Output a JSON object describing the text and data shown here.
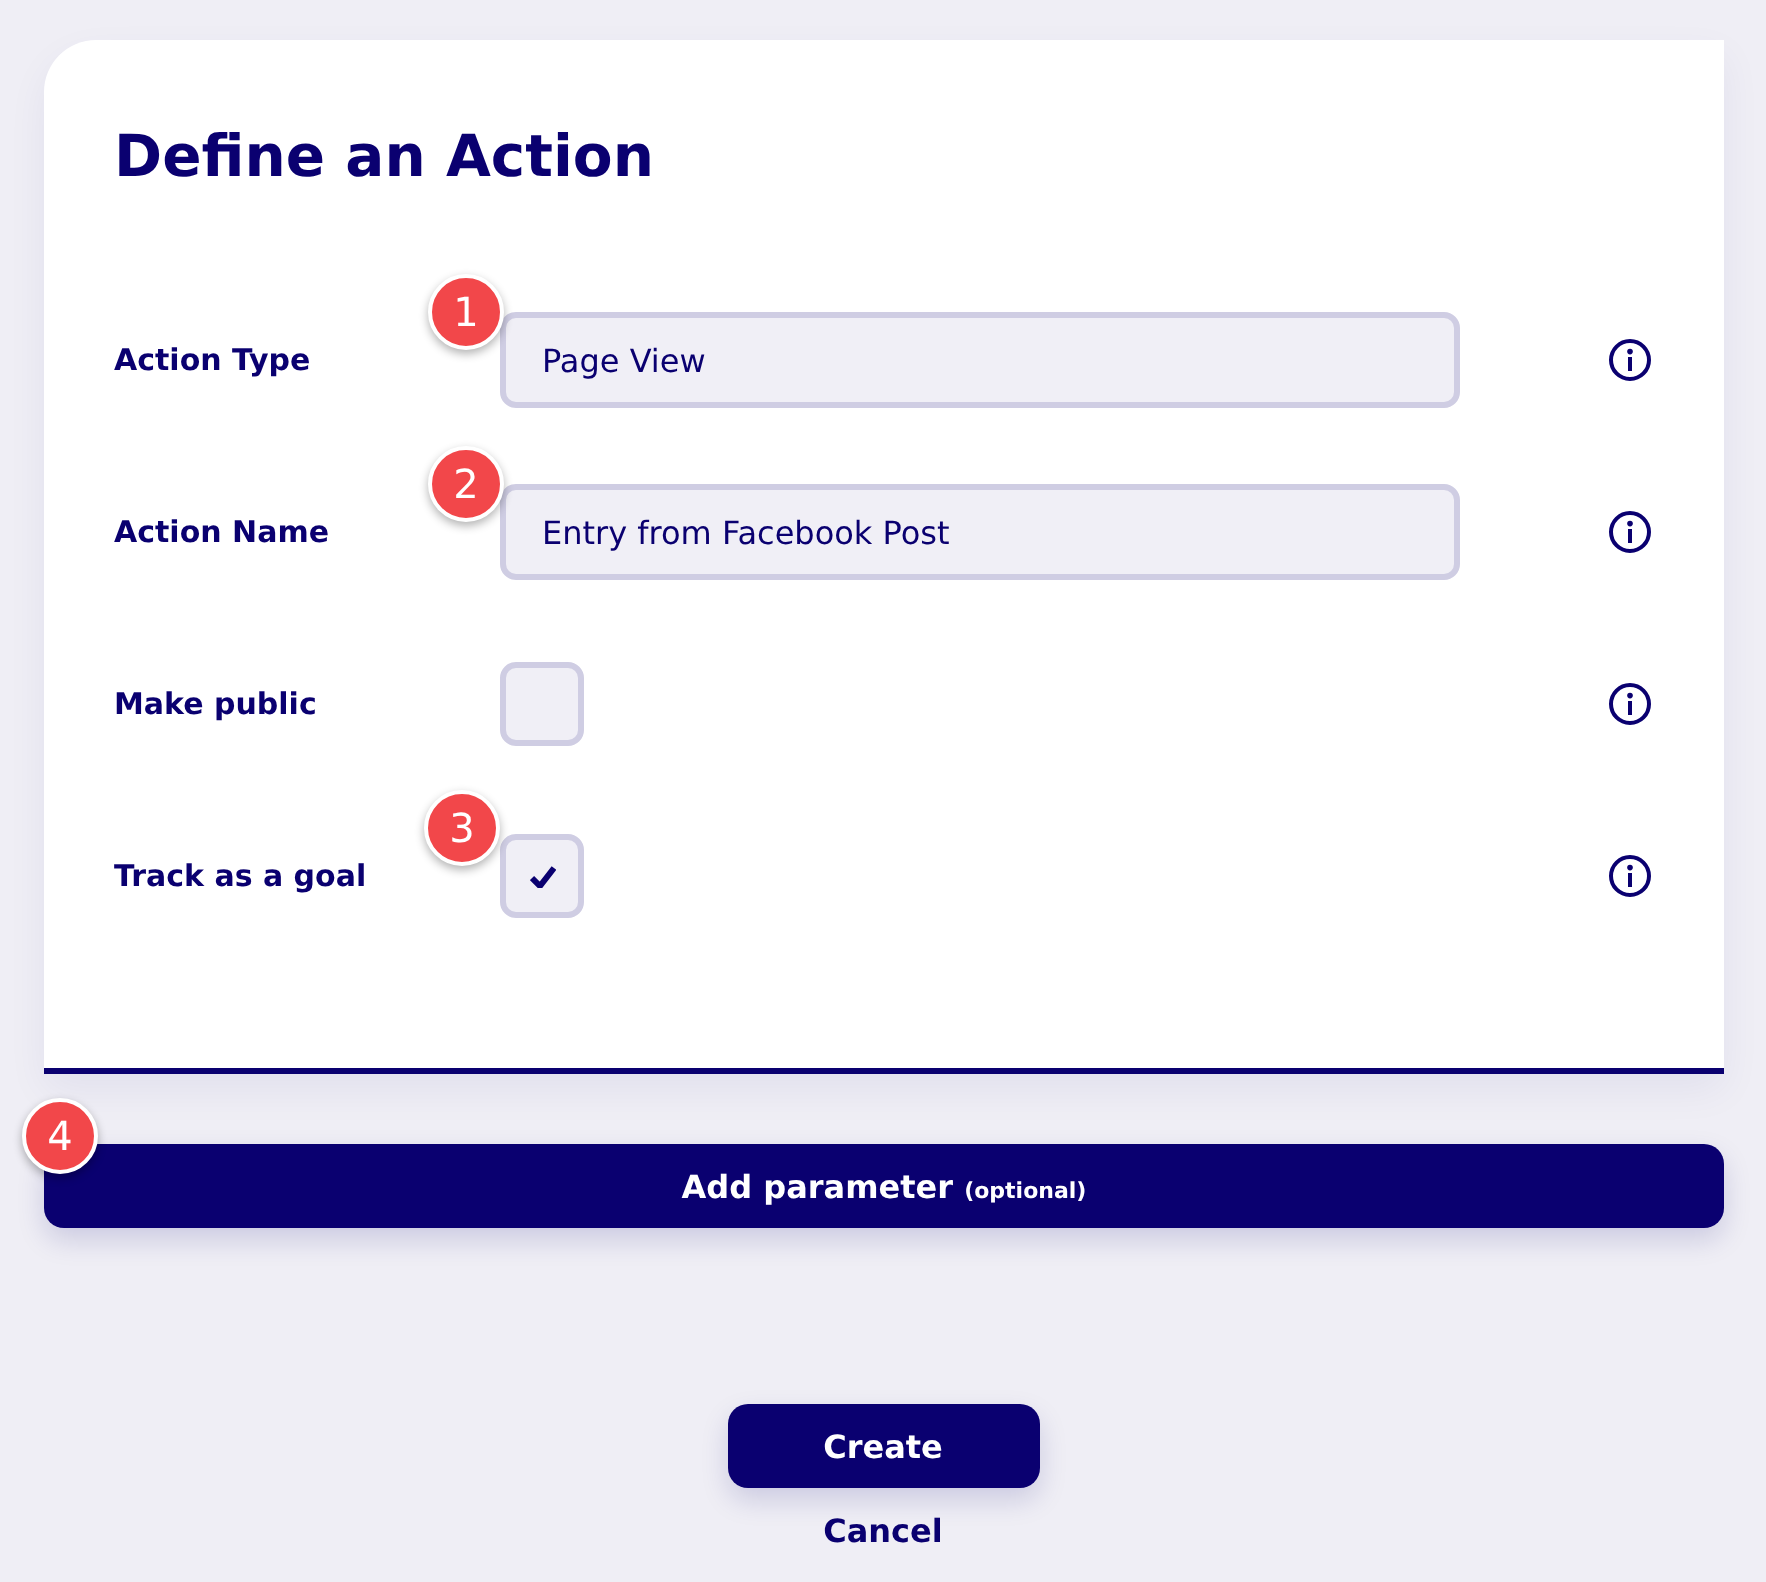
{
  "title": "Define an Action",
  "fields": [
    {
      "kind": "text",
      "label": "Action Type",
      "value": "Page View",
      "badge": "1"
    },
    {
      "kind": "text",
      "label": "Action Name",
      "value": "Entry from Facebook Post",
      "badge": "2"
    },
    {
      "kind": "checkbox",
      "label": "Make public",
      "checked": false
    },
    {
      "kind": "checkbox",
      "label": "Track as a goal",
      "checked": true,
      "badge": "3"
    }
  ],
  "add_button": {
    "label": "Add parameter",
    "note": "(optional)",
    "badge": "4"
  },
  "create_button": "Create",
  "cancel_link": "Cancel"
}
